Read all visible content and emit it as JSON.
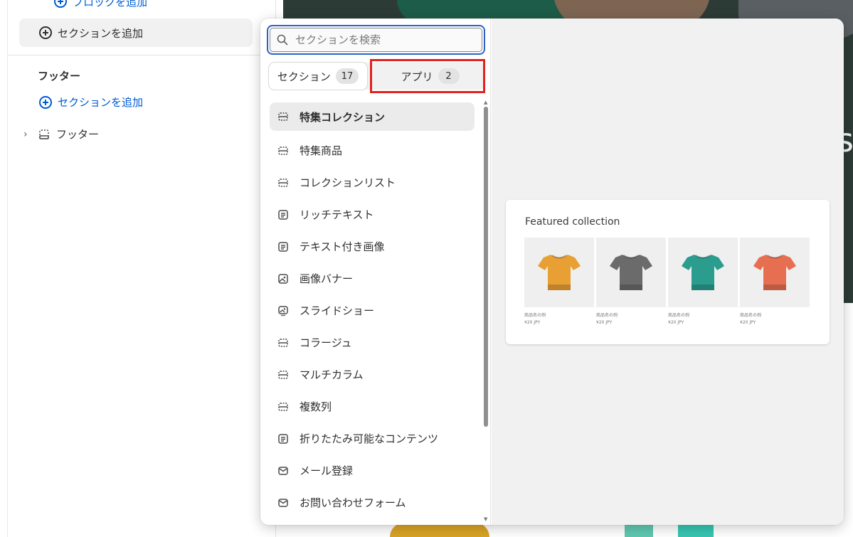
{
  "sidebar": {
    "add_block_label": "ブロックを追加",
    "add_section_label": "セクションを追加",
    "footer_heading": "フッター",
    "footer_add_section_label": "セクションを追加",
    "footer_item_label": "フッター"
  },
  "preview": {
    "hero_letter": "s"
  },
  "popup": {
    "search": {
      "placeholder": "セクションを検索",
      "value": ""
    },
    "tabs": [
      {
        "label": "セクション",
        "count": "17",
        "active": true
      },
      {
        "label": "アプリ",
        "count": "2",
        "active": false
      }
    ],
    "items": [
      {
        "label": "特集コレクション",
        "icon": "section-icon",
        "selected": true
      },
      {
        "label": "特集商品",
        "icon": "section-icon"
      },
      {
        "label": "コレクションリスト",
        "icon": "section-icon"
      },
      {
        "label": "リッチテキスト",
        "icon": "text-icon"
      },
      {
        "label": "テキスト付き画像",
        "icon": "text-icon"
      },
      {
        "label": "画像バナー",
        "icon": "image-icon"
      },
      {
        "label": "スライドショー",
        "icon": "slideshow-icon"
      },
      {
        "label": "コラージュ",
        "icon": "section-icon"
      },
      {
        "label": "マルチカラム",
        "icon": "section-icon"
      },
      {
        "label": "複数列",
        "icon": "section-icon"
      },
      {
        "label": "折りたたみ可能なコンテンツ",
        "icon": "text-icon"
      },
      {
        "label": "メール登録",
        "icon": "mail-icon"
      },
      {
        "label": "お問い合わせフォーム",
        "icon": "mail-icon"
      }
    ],
    "preview_card": {
      "title": "Featured collection",
      "products": [
        {
          "name": "商品名の例",
          "price": "¥20 JPY",
          "color": "#e8a034"
        },
        {
          "name": "商品名の例",
          "price": "¥20 JPY",
          "color": "#6b6b6b"
        },
        {
          "name": "商品名の例",
          "price": "¥20 JPY",
          "color": "#2a9d8f"
        },
        {
          "name": "商品名の例",
          "price": "¥20 JPY",
          "color": "#e76f51"
        }
      ]
    }
  },
  "colors": {
    "link_blue": "#005bd3",
    "highlight_red": "#e0231d",
    "focus_blue": "#2a63c7"
  }
}
